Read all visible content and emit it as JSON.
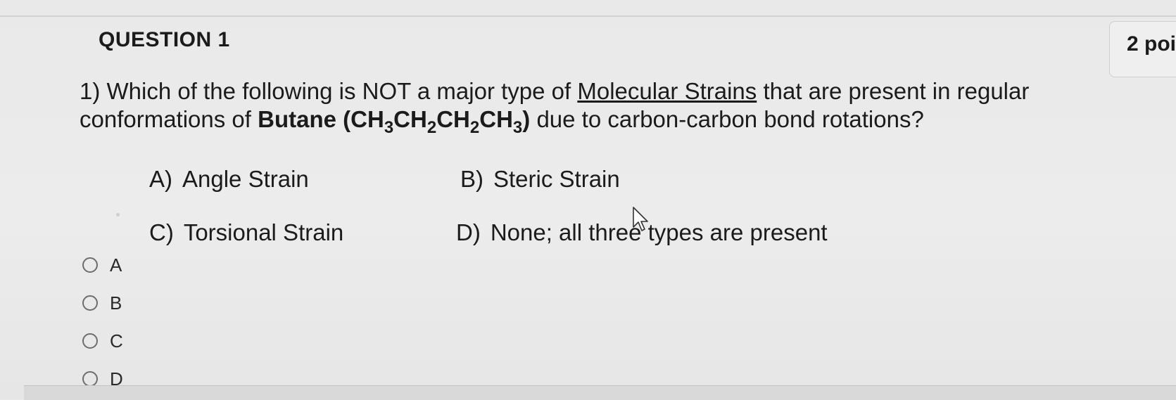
{
  "question": {
    "title": "QUESTION 1",
    "points": "2 poi",
    "number": "1)",
    "text_part1": "Which of the following is NOT a major type of",
    "text_underlined": "Molecular Strains",
    "text_part2": "that are present in regular conformations of",
    "butane_label": "Butane",
    "formula": {
      "open": "(CH",
      "sub1": "3",
      "mid1": "CH",
      "sub2": "2",
      "mid2": "CH",
      "sub3": "2",
      "mid3": "CH",
      "sub4": "3",
      "close": ")"
    },
    "text_part3": "due to carbon-carbon bond rotations?"
  },
  "options": [
    {
      "letter": "A)",
      "text": "Angle Strain"
    },
    {
      "letter": "B)",
      "text": "Steric Strain"
    },
    {
      "letter": "C)",
      "text": "Torsional Strain"
    },
    {
      "letter": "D)",
      "text": "None; all three types are present"
    }
  ],
  "answers": [
    {
      "label": "A"
    },
    {
      "label": "B"
    },
    {
      "label": "C"
    },
    {
      "label": "D"
    }
  ],
  "colors": {
    "background": "#ebebeb",
    "text": "#1b1b1b",
    "radio_border": "#6d6d6d"
  },
  "icons": {
    "cursor": "mouse-pointer-icon",
    "radio": "radio-circle-icon"
  }
}
